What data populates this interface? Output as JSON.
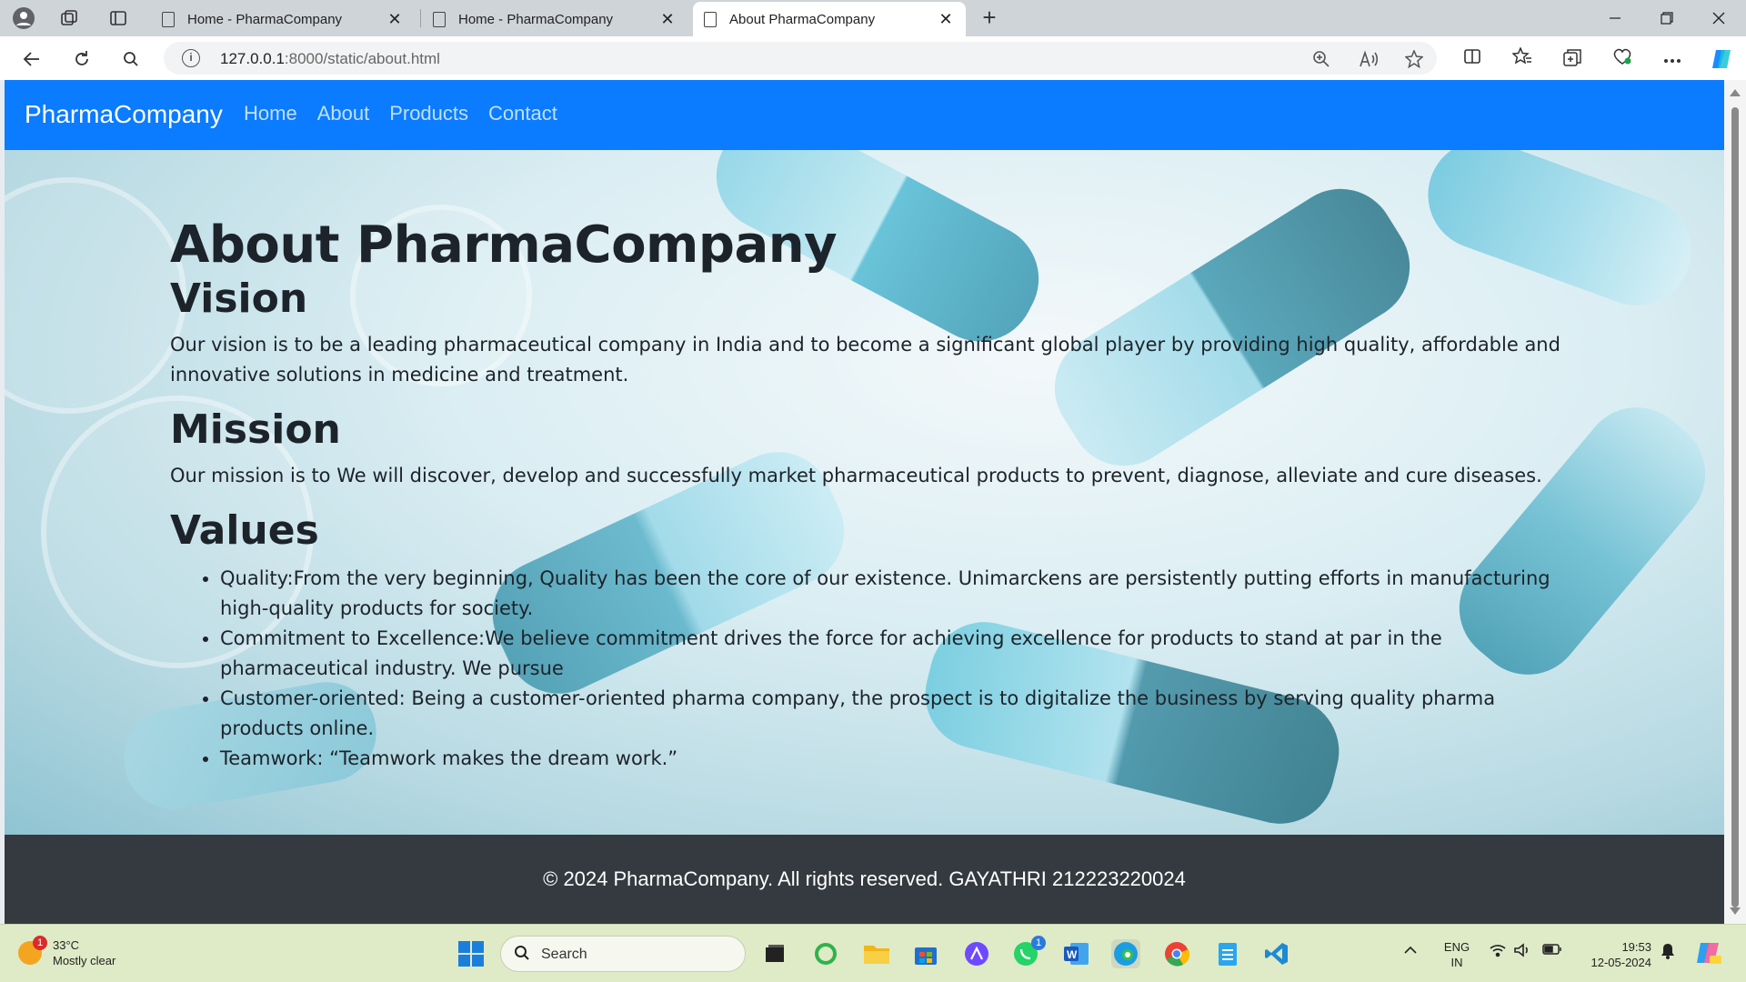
{
  "browser": {
    "tabs": [
      {
        "title": "Home - PharmaCompany",
        "close": "✕"
      },
      {
        "title": "Home - PharmaCompany",
        "close": "✕"
      },
      {
        "title": "About PharmaCompany",
        "close": "✕"
      }
    ],
    "new_tab": "+",
    "address": {
      "host": "127.0.0.1",
      "path": ":8000/static/about.html"
    }
  },
  "site": {
    "brand": "PharmaCompany",
    "nav": [
      "Home",
      "About",
      "Products",
      "Contact"
    ],
    "title": "About PharmaCompany",
    "vision": {
      "heading": "Vision",
      "text": "Our vision is to be a leading pharmaceutical company in India and to become a significant global player by providing high quality, affordable and innovative solutions in medicine and treatment."
    },
    "mission": {
      "heading": "Mission",
      "text": "Our mission is to We will discover, develop and successfully market pharmaceutical products to prevent, diagnose, alleviate and cure diseases."
    },
    "values": {
      "heading": "Values",
      "items": [
        "Quality:From the very beginning, Quality has been the core of our existence. Unimarckens are persistently putting efforts in manufacturing high-quality products for society.",
        "Commitment to Excellence:We believe commitment drives the force for achieving excellence for products to stand at par in the pharmaceutical industry. We pursue",
        "Customer-oriented: Being a customer-oriented pharma company, the prospect is to digitalize the business by serving quality pharma products online.",
        "Teamwork: “Teamwork makes the dream work.”"
      ]
    },
    "footer": "© 2024 PharmaCompany. All rights reserved. GAYATHRI 212223220024"
  },
  "taskbar": {
    "weather": {
      "temp": "33°C",
      "desc": "Mostly clear",
      "badge": "1"
    },
    "search_label": "Search",
    "whatsapp_badge": "1",
    "lang": {
      "line1": "ENG",
      "line2": "IN"
    },
    "clock": {
      "time": "19:53",
      "date": "12-05-2024"
    }
  },
  "colors": {
    "navbar": "#0b7bff",
    "footer": "#343a40",
    "text": "#1d232a"
  }
}
